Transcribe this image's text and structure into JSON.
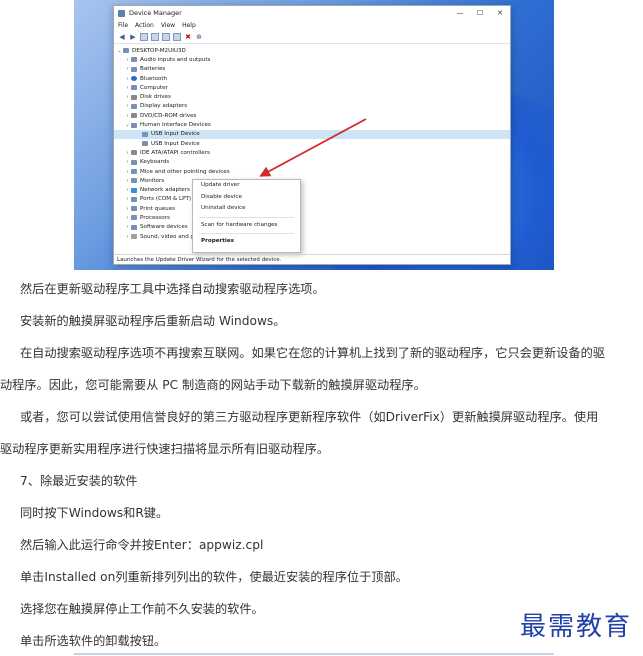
{
  "screenshot": {
    "window_title": "Device Manager",
    "window_buttons": [
      "—",
      "☐",
      "✕"
    ],
    "menu": [
      "File",
      "Action",
      "View",
      "Help"
    ],
    "toolbar_icons": [
      "back-icon",
      "forward-icon",
      "properties-icon",
      "help-icon",
      "scan-icon",
      "monitor-icon",
      "uninstall-icon",
      "update-icon"
    ],
    "computer_name": "DESKTOP-M2UIU3D",
    "tree": [
      {
        "label": "Audio inputs and outputs",
        "icon": "audio-icon"
      },
      {
        "label": "Batteries",
        "icon": "battery-icon"
      },
      {
        "label": "Bluetooth",
        "icon": "bluetooth-icon"
      },
      {
        "label": "Computer",
        "icon": "computer-icon"
      },
      {
        "label": "Disk drives",
        "icon": "disk-icon"
      },
      {
        "label": "Display adapters",
        "icon": "display-icon"
      },
      {
        "label": "DVD/CD-ROM drives",
        "icon": "dvd-icon"
      },
      {
        "label": "Human Interface Devices",
        "icon": "hid-icon",
        "expanded": true,
        "children": [
          "USB Input Device",
          "USB Input Device"
        ]
      },
      {
        "label": "IDE ATA/ATAPI controllers",
        "icon": "ide-icon"
      },
      {
        "label": "Keyboards",
        "icon": "keyboard-icon"
      },
      {
        "label": "Mice and other pointing devices",
        "icon": "mouse-icon"
      },
      {
        "label": "Monitors",
        "icon": "monitor-icon"
      },
      {
        "label": "Network adapters",
        "icon": "network-icon"
      },
      {
        "label": "Ports (COM & LPT)",
        "icon": "port-icon"
      },
      {
        "label": "Print queues",
        "icon": "print-icon"
      },
      {
        "label": "Processors",
        "icon": "cpu-icon"
      },
      {
        "label": "Software devices",
        "icon": "software-icon"
      },
      {
        "label": "Sound, video and game controllers",
        "icon": "sound-icon"
      }
    ],
    "context_menu": {
      "update_driver": "Update driver",
      "disable_device": "Disable device",
      "uninstall_device": "Uninstall device",
      "scan": "Scan for hardware changes",
      "properties": "Properties"
    },
    "status": "Launches the Update Driver Wizard for the selected device.",
    "arrow_color": "#d62a2a"
  },
  "paragraphs": [
    "然后在更新驱动程序工具中选择自动搜索驱动程序选项。",
    "安装新的触摸屏驱动程序后重新启动 Windows。",
    "在自动搜索驱动程序选项不再搜索互联网。如果它在您的计算机上找到了新的驱动程序，它只会更新设备的驱",
    "动程序。因此，您可能需要从 PC 制造商的网站手动下载新的触摸屏驱动程序。",
    "或者，您可以尝试使用信誉良好的第三方驱动程序更新程序软件（如DriverFix）更新触摸屏驱动程序。使用",
    "驱动程序更新实用程序进行快速扫描将显示所有旧驱动程序。",
    "7、除最近安装的软件",
    "同时按下Windows和R键。",
    "然后输入此运行命令并按Enter：appwiz.cpl",
    "单击Installed on列重新排列列出的软件，使最近安装的程序位于顶部。",
    "选择您在触摸屏停止工作前不久安装的软件。",
    "单击所选软件的卸载按钮。"
  ],
  "watermark": "最需教育",
  "colors": {
    "text": "#333333",
    "watermark": "#2141a8",
    "selection": "#cde4f7"
  }
}
